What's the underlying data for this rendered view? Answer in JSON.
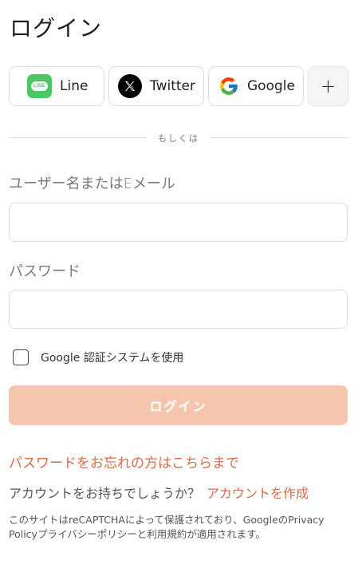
{
  "page": {
    "title": "ログイン"
  },
  "social": {
    "line": {
      "label": "Line",
      "icon": "line-icon",
      "icon_text": "LINE",
      "color": "#4cc764"
    },
    "twitter": {
      "label": "Twitter",
      "icon": "x-logo-icon"
    },
    "google": {
      "label": "Google",
      "icon": "google-g-icon"
    },
    "more": {
      "label": "+",
      "icon": "plus-icon"
    }
  },
  "divider": {
    "text": "もしくは"
  },
  "form": {
    "username_label": "ユーザー名またはEメール",
    "username_value": "",
    "password_label": "パスワード",
    "password_value": "",
    "google_auth_label": "Google 認証システムを使用",
    "google_auth_checked": false,
    "login_button": "ログイン"
  },
  "links": {
    "forgot_password": "パスワードをお忘れの方はこちらまで",
    "have_account_question": "アカウントをお持ちでしょうか？",
    "create_account": "アカウントを作成"
  },
  "recaptcha": {
    "notice": "このサイトはreCAPTCHAによって保護されており、GoogleのPrivacy Policyプライバシーポリシーと利用規約が適用されます。"
  },
  "colors": {
    "accent": "#d96a47",
    "login_button_bg": "#f5c5ae",
    "line_green": "#4cc764"
  }
}
